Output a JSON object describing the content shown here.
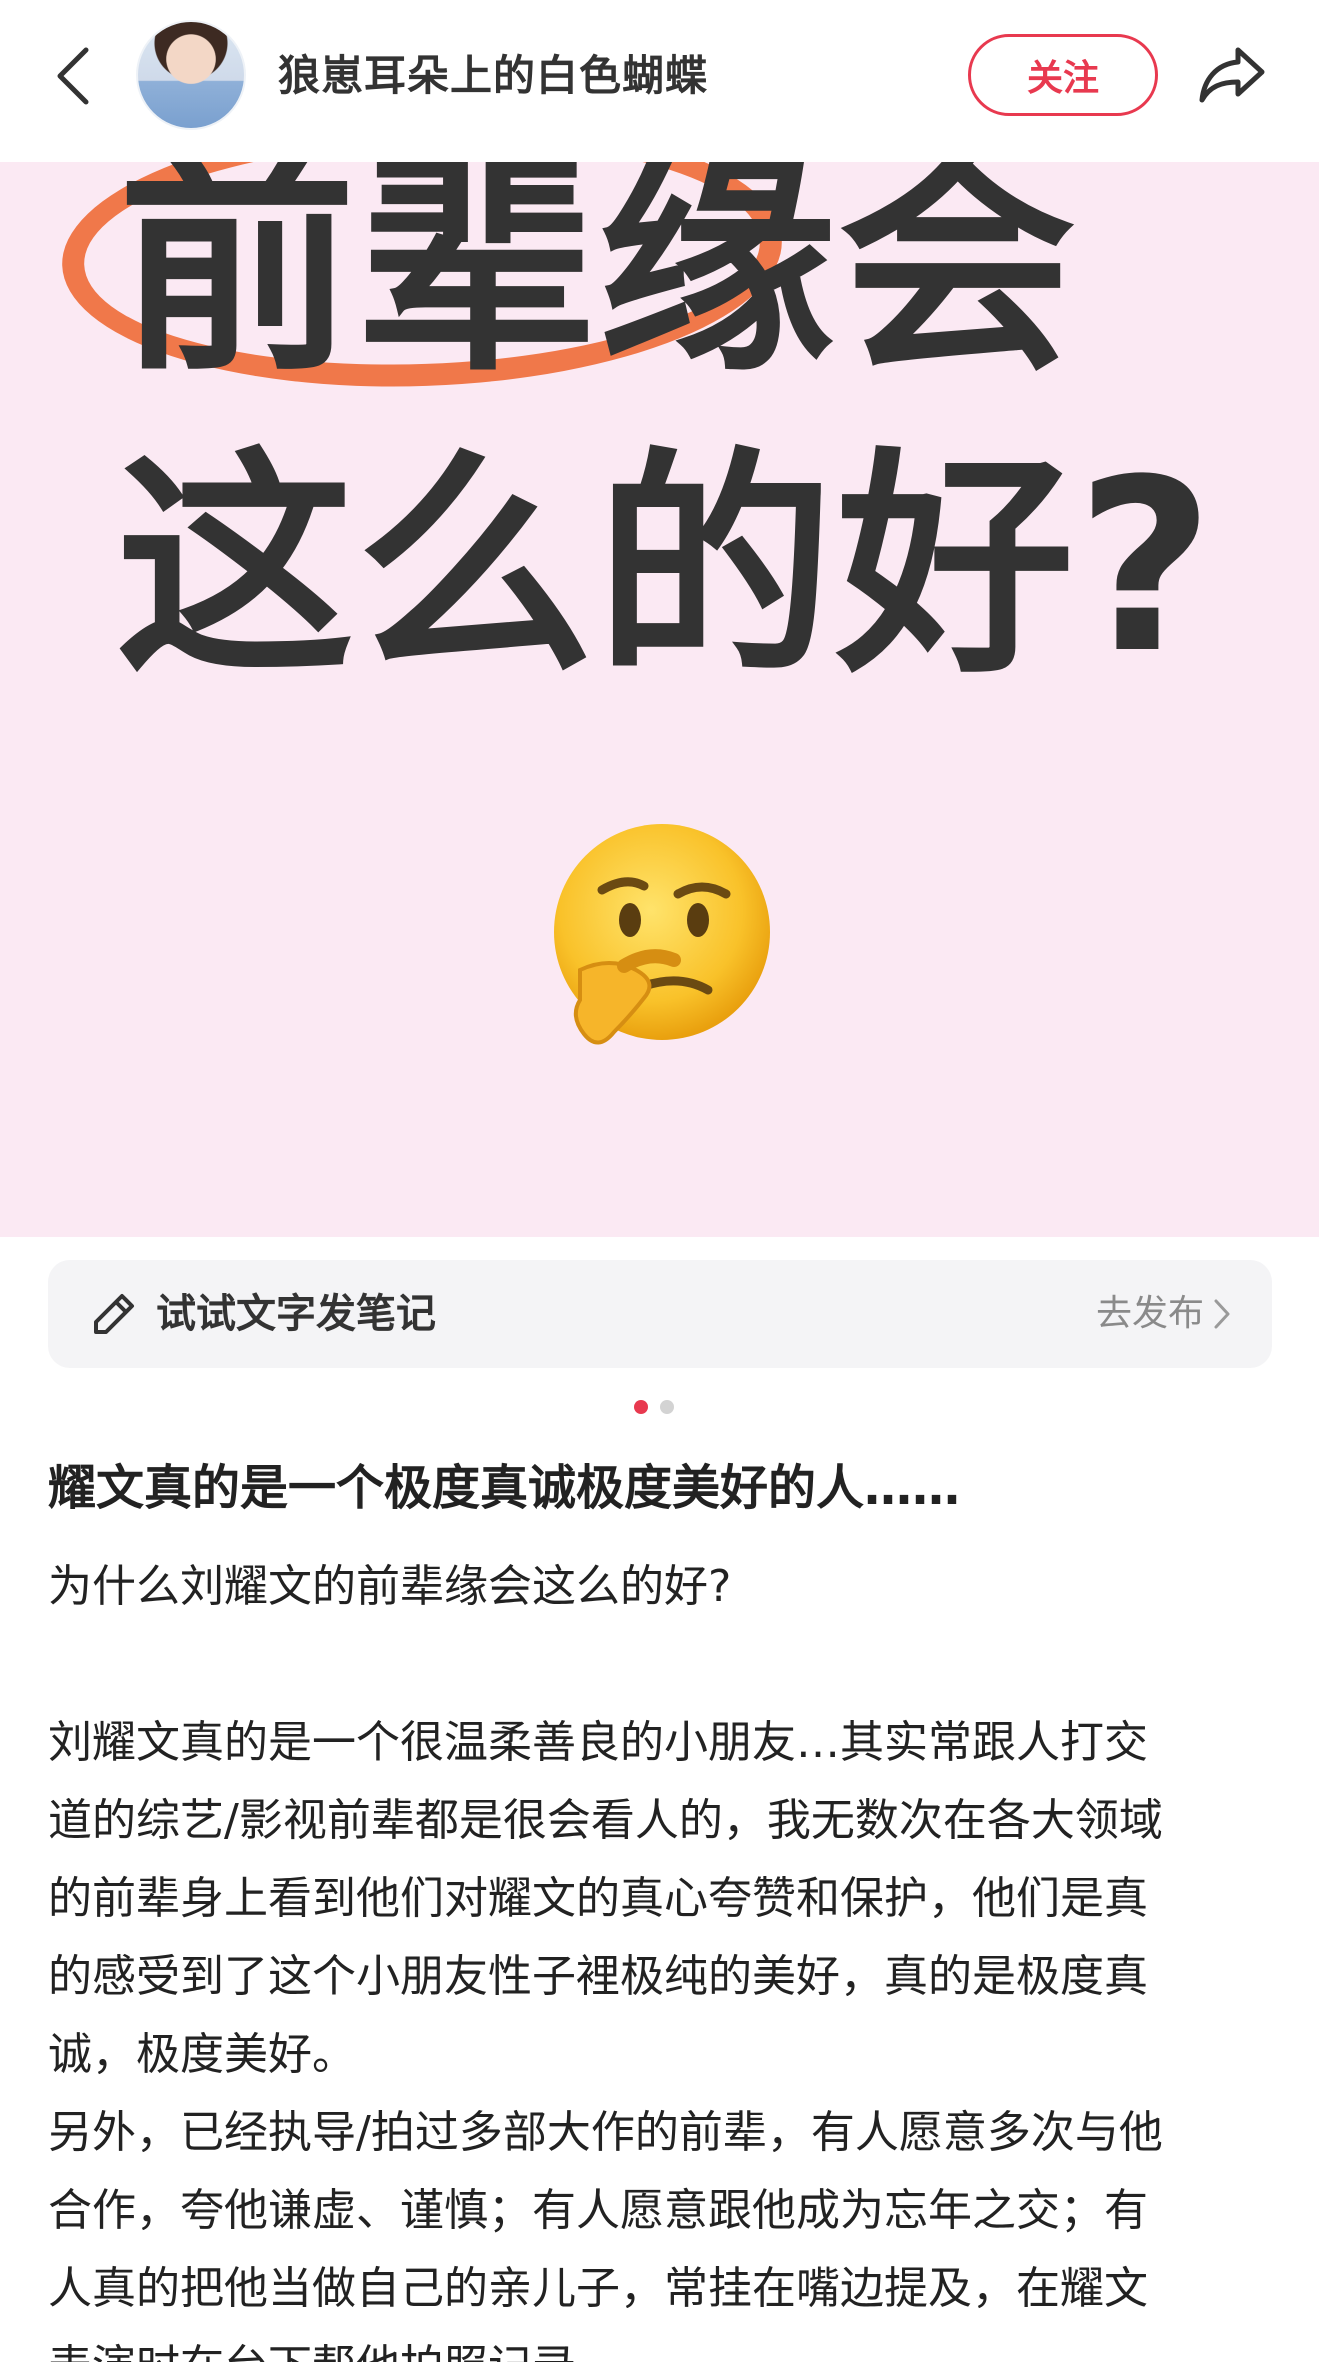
{
  "header": {
    "username": "狼崽耳朵上的白色蝴蝶",
    "follow_label": "关注"
  },
  "hero": {
    "line1": "前辈缘会",
    "line2": "这么的好?"
  },
  "note_bar": {
    "label": "试试文字发笔记",
    "action_label": "去发布"
  },
  "pagination": {
    "total": 2,
    "current": 1
  },
  "post": {
    "title": "耀文真的是一个极度真诚极度美好的人……",
    "lines": [
      "为什么刘耀文的前辈缘会这么的好?",
      "",
      "刘耀文真的是一个很温柔善良的小朋友…其实常跟人打交",
      "道的综艺/影视前辈都是很会看人的，我无数次在各大领域",
      "的前辈身上看到他们对耀文的真心夸赞和保护，他们是真",
      "的感受到了这个小朋友性子裡极纯的美好，真的是极度真",
      "诚，极度美好。",
      "另外，已经执导/拍过多部大作的前辈，有人愿意多次与他",
      "合作，夸他谦虚、谨慎；有人愿意跟他成为忘年之交；有",
      "人真的把他当做自己的亲儿子，常挂在嘴边提及，在耀文",
      "表演时在台下帮他拍照记录"
    ]
  },
  "colors": {
    "accent": "#e8394f",
    "hero_bg": "#fbe9f3",
    "circle": "#f0784a"
  }
}
